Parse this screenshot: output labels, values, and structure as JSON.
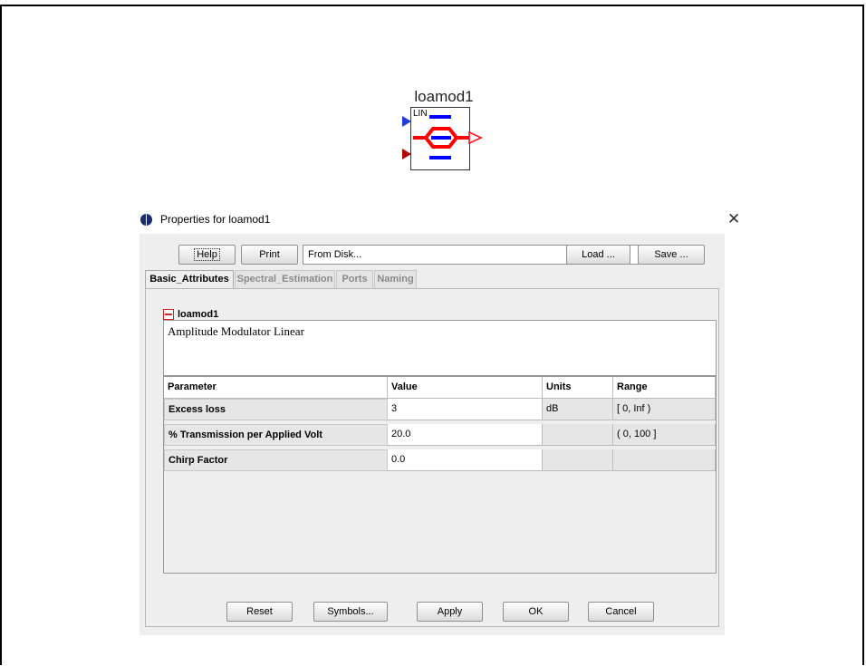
{
  "canvas": {
    "block_name": "loamod1",
    "block_tag": "LIN",
    "colors": {
      "block_red": "#ff0000",
      "block_blue": "#0000ff",
      "port_blue": "#1f3bd6",
      "port_red": "#b00000"
    }
  },
  "dialog": {
    "title": "Properties for loamod1",
    "close_glyph": "✕",
    "toolbar": {
      "help": "Help",
      "print": "Print",
      "source_value": "From Disk...",
      "load": "Load ...",
      "save": "Save ..."
    },
    "tabs": [
      "Basic_Attributes",
      "Spectral_Estimation",
      "Ports",
      "Naming"
    ],
    "component": {
      "name": "loamod1",
      "description": "Amplitude Modulator Linear"
    },
    "table": {
      "headers": [
        "Parameter",
        "Value",
        "Units",
        "Range"
      ],
      "rows": [
        [
          "Excess loss",
          "3",
          "dB",
          "[ 0, Inf )"
        ],
        [
          "% Transmission per Applied Volt",
          "20.0",
          "",
          "( 0, 100 ]"
        ],
        [
          "Chirp Factor",
          "0.0",
          "",
          ""
        ]
      ]
    },
    "footer": {
      "reset": "Reset",
      "symbols": "Symbols...",
      "apply": "Apply",
      "ok": "OK",
      "cancel": "Cancel"
    }
  }
}
